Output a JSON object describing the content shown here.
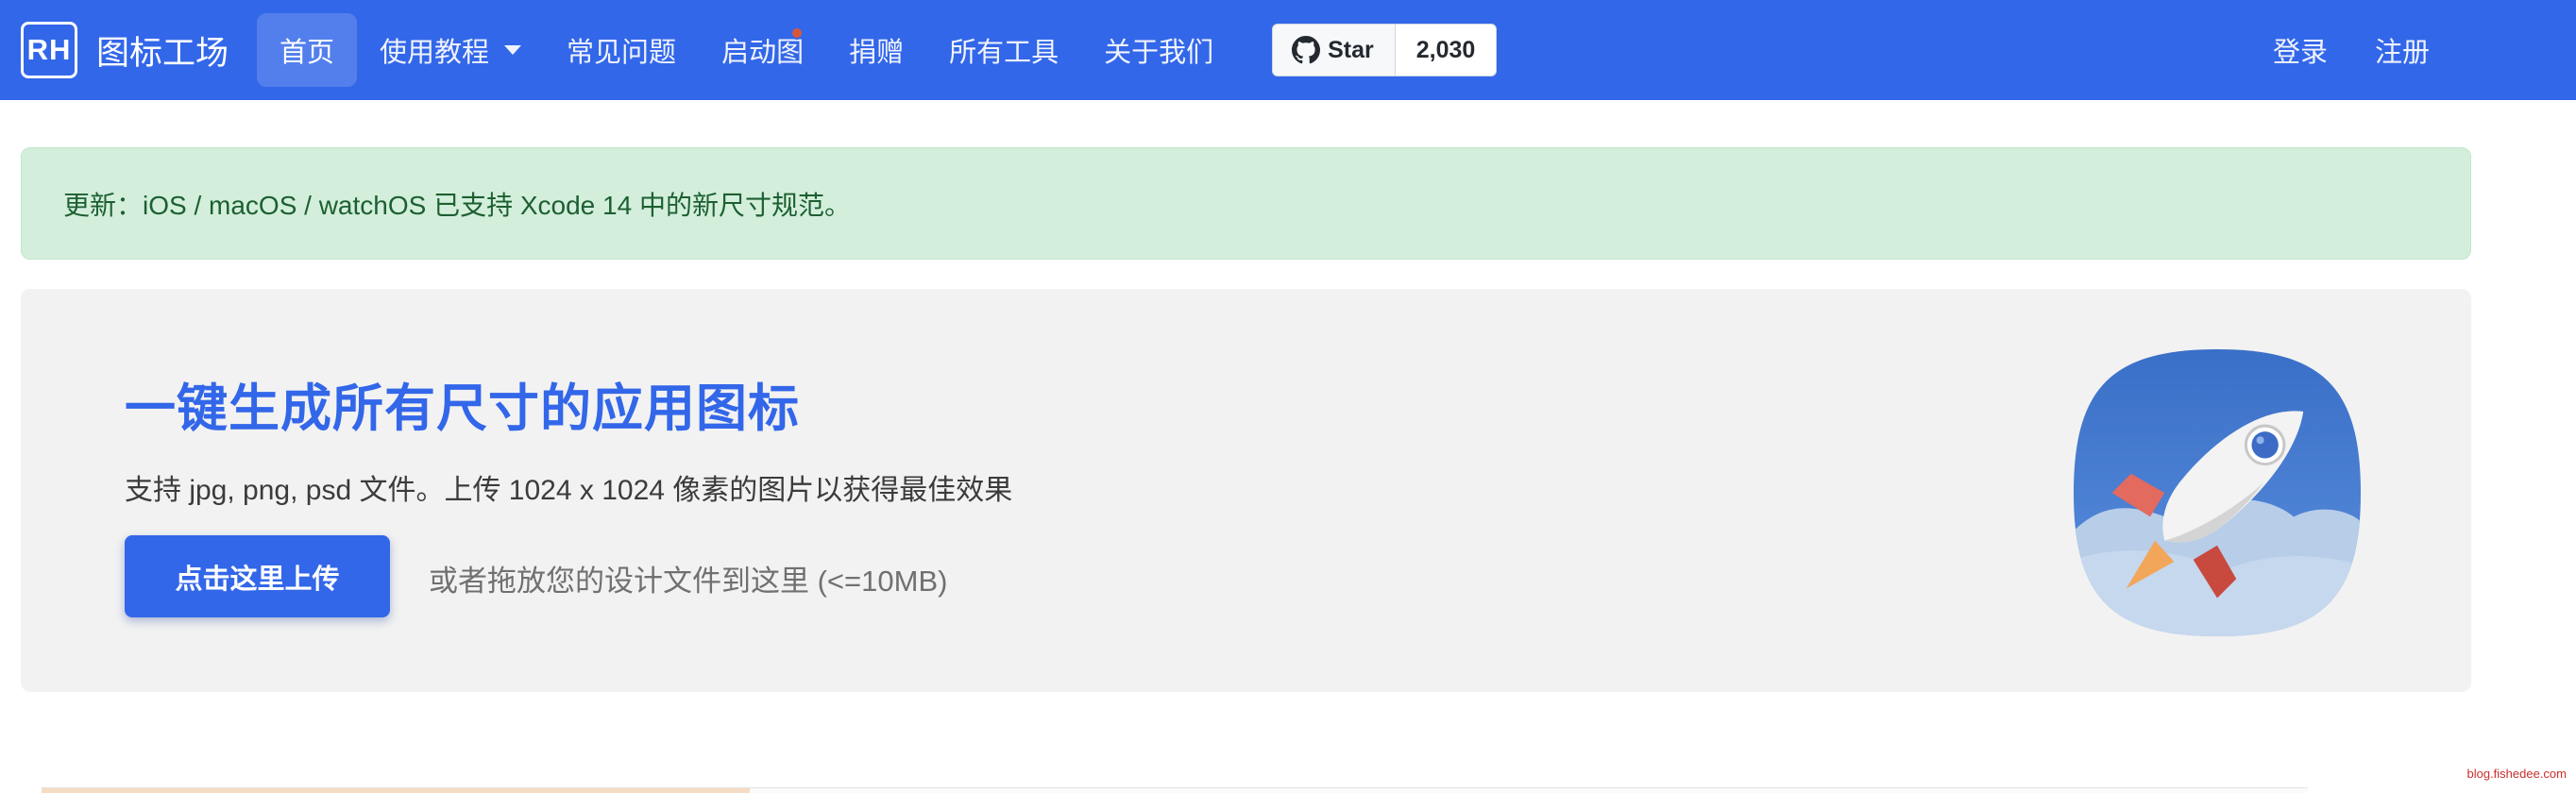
{
  "brand": {
    "logo_text": "RH",
    "name": "图标工场"
  },
  "nav": {
    "items": [
      {
        "label": "首页",
        "active": true
      },
      {
        "label": "使用教程",
        "dropdown": true
      },
      {
        "label": "常见问题"
      },
      {
        "label": "启动图",
        "badge": true
      },
      {
        "label": "捐赠"
      },
      {
        "label": "所有工具"
      },
      {
        "label": "关于我们"
      }
    ],
    "github": {
      "button_label": "Star",
      "count": "2,030"
    },
    "login_label": "登录",
    "register_label": "注册"
  },
  "alert": {
    "text": "更新：iOS / macOS / watchOS 已支持 Xcode 14 中的新尺寸规范。"
  },
  "hero": {
    "title": "一键生成所有尺寸的应用图标",
    "subtitle": "支持 jpg, png, psd 文件。上传 1024 x 1024 像素的图片以获得最佳效果",
    "upload_label": "点击这里上传",
    "drop_hint": "或者拖放您的设计文件到这里 (<=10MB)",
    "icon": "rocket-app-icon"
  },
  "watermark": "blog.fishedee.com",
  "colors": {
    "primary": "#3367e9",
    "alert_bg": "#d3efdc",
    "alert_text": "#1d5f31",
    "hero_bg": "#f2f2f2",
    "badge": "#e4572e"
  }
}
